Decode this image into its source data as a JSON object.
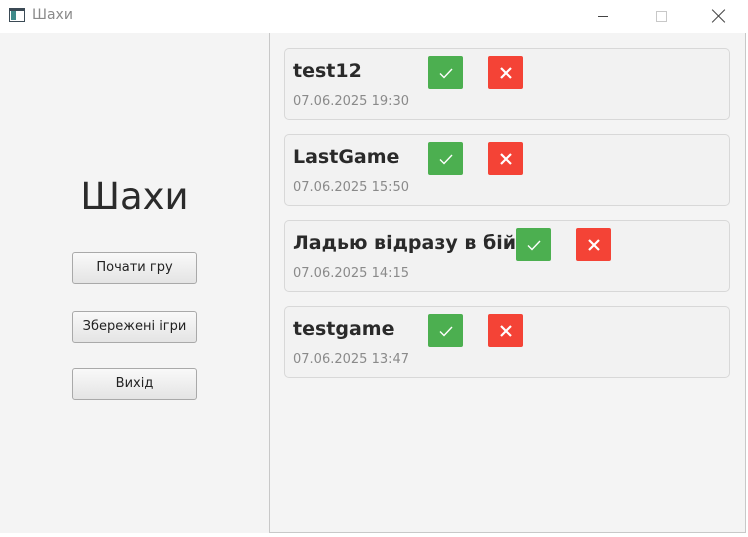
{
  "window": {
    "title": "Шахи",
    "icon": "app-window-icon",
    "controls": [
      "minimize-icon",
      "maximize-icon",
      "close-icon"
    ]
  },
  "sidebar": {
    "title": "Шахи",
    "buttons": [
      {
        "label": "Почати гру"
      },
      {
        "label": "Збережені ігри"
      },
      {
        "label": "Вихід"
      }
    ]
  },
  "saved_games": [
    {
      "name": "test12",
      "date": "07.06.2025 19:30",
      "load_icon": "check-icon",
      "delete_icon": "cross-icon"
    },
    {
      "name": "LastGame",
      "date": "07.06.2025 15:50",
      "load_icon": "check-icon",
      "delete_icon": "cross-icon"
    },
    {
      "name": "Ладью відразу в бій",
      "date": "07.06.2025 14:15",
      "load_icon": "check-icon",
      "delete_icon": "cross-icon"
    },
    {
      "name": "testgame",
      "date": "07.06.2025 13:47",
      "load_icon": "check-icon",
      "delete_icon": "cross-icon"
    }
  ],
  "colors": {
    "load_button": "#4caf50",
    "delete_button": "#f44336"
  }
}
